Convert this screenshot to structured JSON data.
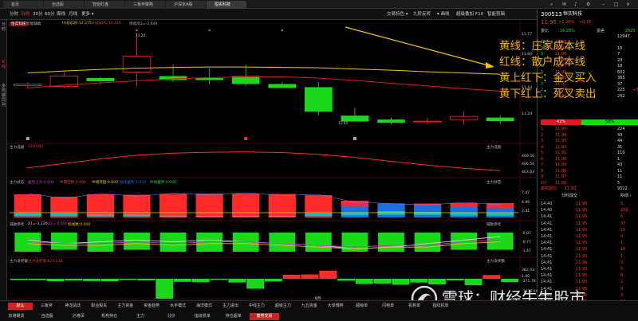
{
  "top_tabs": [
    "首页",
    "自选股",
    "智能盯盘",
    "三板斧策略",
    "沪深京A股",
    "恒实科技"
  ],
  "toolbar": {
    "left": [
      "分时",
      "日线",
      "30分",
      "60分",
      "周线",
      "月线",
      "更多 ▾"
    ],
    "right": [
      "交易特色 ▾",
      "九阶反转",
      "▾ 画线",
      "超级叠加",
      "F10",
      "智能剪辑"
    ],
    "right_icons": [
      "search-icon",
      "mail-icon",
      "notification-icon",
      "settings-icon",
      "minimize-icon",
      "maximize-icon",
      "close-icon"
    ]
  },
  "left_nav": [
    "分时",
    "K线",
    "多周期同列"
  ],
  "main_panel": {
    "name": "恒实科技",
    "tag": "智能辅助",
    "ma": [
      "HHJSJDB:12.275",
      "HHJSJDC:12.420",
      "感观高3=-2.649"
    ],
    "price_labels": [
      "11.77",
      "11.60",
      "11.44",
      "11.24"
    ],
    "high_label": "13.20",
    "low_label": "11.44"
  },
  "panel2": {
    "title": "主力选股",
    "value": "420.090",
    "right_title": "主力选股",
    "axis": [
      "409.50",
      "406.56",
      "403.63"
    ]
  },
  "panel3": {
    "title": "主力状态",
    "items": [
      "蓄势上升:0.000",
      "中期空换:0.900",
      "中线持盘:0.000",
      "短线蓄势:1.252",
      "中线蓄势:0.000"
    ],
    "right_title": "主力状态",
    "axis": [
      "7.47",
      "4.96",
      "2.41"
    ]
  },
  "panel4": {
    "title": "辅助参考",
    "items": [
      "X1=-1.120",
      "X2=-0.690",
      "标线数:0.000"
    ],
    "right_title": "辅助参考",
    "axis": [
      "-0.07",
      "-0.77",
      "-1.47"
    ]
  },
  "panel5": {
    "title": "主力净买额",
    "value": "主力净买额:823.238",
    "right_title": "主力净买额",
    "axis": [
      "382.03",
      "1.00",
      "-371.78",
      "-1476.66"
    ]
  },
  "x_axis_label": "8月",
  "quote": {
    "code": "300513",
    "name": "恒实科技",
    "price": "11.95",
    "change": "+1.36%",
    "change_amt": "+0.16",
    "wb_label": "委比",
    "wb_value": "-16.28%",
    "wc_label": "委差",
    "wc_value": "-2625",
    "volume": "12947",
    "ratio_sell": "42%",
    "ratio_buy": "58%",
    "sell_rows": [
      [
        "10",
        "11.98",
        ""
      ],
      [
        "9",
        "11.97",
        "16"
      ],
      [
        "8",
        "11.96",
        "7"
      ],
      [
        "7",
        "11.96",
        "23"
      ],
      [
        "6",
        "11.97",
        "18"
      ],
      [
        "5",
        "11.96",
        "602"
      ],
      [
        "4",
        "11.96",
        "365"
      ],
      [
        "3",
        "11.97",
        "37"
      ],
      [
        "2",
        "11.97",
        "225"
      ],
      [
        "1",
        "11.96",
        "242"
      ]
    ],
    "sell_changes": [
      "",
      "",
      "",
      "",
      "",
      "",
      "",
      "",
      "+3",
      ""
    ],
    "buy_rows": [
      [
        "1",
        "11.95",
        "224"
      ],
      [
        "2",
        "11.94",
        "43"
      ],
      [
        "3",
        "11.93",
        "44"
      ],
      [
        "4",
        "11.92",
        "31"
      ],
      [
        "5",
        "11.91",
        "110"
      ],
      [
        "6",
        "11.90",
        "1"
      ],
      [
        "7",
        "11.89",
        "43"
      ],
      [
        "8",
        "11.88",
        "11"
      ],
      [
        "9",
        "11.87",
        "11"
      ],
      [
        "10",
        "11.86",
        "5"
      ]
    ],
    "avg_label": "委买期均",
    "avg_value": "11.60",
    "avg_vol": "9322",
    "trade_header_left": "分时成交",
    "trade_header_right": "明细 ›",
    "trades": [
      [
        "14:40",
        "11.95",
        "5"
      ],
      [
        "14:40",
        "11.95",
        "208"
      ],
      [
        "14:41",
        "11.95",
        "6"
      ],
      [
        "14:41",
        "11.95",
        "37"
      ],
      [
        "14:41",
        "11.95",
        "10"
      ],
      [
        "14:41",
        "11.95",
        "4"
      ],
      [
        "14:41",
        "11.95",
        "1"
      ],
      [
        "14:41",
        "11.95",
        "16"
      ],
      [
        "14:41",
        "11.95",
        "1"
      ],
      [
        "14:41",
        "11.96",
        "3"
      ],
      [
        "14:41",
        "11.95",
        "5"
      ],
      [
        "14:41",
        "11.95",
        "8"
      ],
      [
        "14:41",
        "11.95",
        "2"
      ],
      [
        "14:41",
        "11.95",
        "9"
      ],
      [
        "14:41",
        "11.96",
        "3"
      ],
      [
        "14:41",
        "11.95",
        "10"
      ]
    ]
  },
  "annotation": [
    "黄线：庄家成本线",
    "红线：散户成本线",
    "黄上红下：金叉买入",
    "黄下红上：死叉卖出"
  ],
  "watermark": "雪球：财经牛牛股市",
  "bottom_tabs_row1": [
    "默认",
    "三板斧",
    "神龙战法",
    "职业股东",
    "主力资金",
    "资金趋势",
    "水手模式",
    "海洋模式",
    "主力进出",
    "中线主力",
    "超级主力",
    "九五资金",
    "大单博弈",
    "超级单",
    "闪电单",
    "机构单",
    "指纹机单"
  ],
  "bottom_tabs_row2": [
    "京港期货",
    "自选股",
    "沪港深",
    "机构持仓",
    "主力",
    "分价",
    "指纹机单",
    "持仓超单",
    "蓄势交易"
  ],
  "chart_data": {
    "type": "candlestick",
    "candles": [
      {
        "o": 11.86,
        "h": 11.95,
        "l": 11.8,
        "c": 11.9
      },
      {
        "o": 11.84,
        "h": 12.2,
        "l": 11.8,
        "c": 12.1
      },
      {
        "o": 12.05,
        "h": 12.08,
        "l": 11.9,
        "c": 11.97
      },
      {
        "o": 12.2,
        "h": 13.2,
        "l": 11.83,
        "c": 12.6
      },
      {
        "o": 12.1,
        "h": 12.4,
        "l": 11.95,
        "c": 12.0
      },
      {
        "o": 12.05,
        "h": 12.3,
        "l": 11.9,
        "c": 12.0
      },
      {
        "o": 12.1,
        "h": 12.4,
        "l": 11.85,
        "c": 11.9
      },
      {
        "o": 11.9,
        "h": 11.95,
        "l": 11.8,
        "c": 11.8
      },
      {
        "o": 11.82,
        "h": 11.95,
        "l": 11.1,
        "c": 11.2
      },
      {
        "o": 11.1,
        "h": 11.3,
        "l": 10.95,
        "c": 10.95
      },
      {
        "o": 11.0,
        "h": 11.05,
        "l": 10.88,
        "c": 10.92
      },
      {
        "o": 10.96,
        "h": 11.05,
        "l": 10.88,
        "c": 10.96
      },
      {
        "o": 11.0,
        "h": 11.2,
        "l": 10.86,
        "c": 11.08
      },
      {
        "o": 11.05,
        "h": 11.1,
        "l": 10.88,
        "c": 10.96
      }
    ],
    "yellow_line": [
      12.18,
      12.23,
      12.27,
      12.3,
      12.32,
      12.33,
      12.33,
      12.32,
      12.31,
      12.28,
      12.25,
      12.21,
      12.18,
      12.15
    ],
    "red_line": [
      11.8,
      11.87,
      11.93,
      11.98,
      12.03,
      12.06,
      12.08,
      12.08,
      12.05,
      11.99,
      11.92,
      11.85,
      11.78,
      11.72
    ],
    "panel2_line": [
      404.5,
      406.0,
      407.5,
      408.7,
      409.4,
      409.7,
      409.8,
      409.6,
      409.0,
      408.0,
      406.7,
      405.4,
      404.4,
      403.6
    ],
    "panel3_bars": [
      [
        0,
        5.8,
        1.0
      ],
      [
        0,
        5.2,
        1.0
      ],
      [
        0,
        5.8,
        0.8
      ],
      [
        0,
        5.7,
        0.8
      ],
      [
        0,
        5.9,
        0.5
      ],
      [
        0,
        6.0,
        0.4
      ],
      [
        0,
        6.0,
        0.4
      ],
      [
        0,
        5.9,
        0.4
      ],
      [
        0,
        5.6,
        1.0
      ],
      [
        1,
        4.2,
        1.3
      ],
      [
        1,
        3.3,
        1.6
      ],
      [
        1,
        3.5,
        1.4
      ],
      [
        1,
        3.6,
        1.2
      ],
      [
        1,
        3.6,
        1.1
      ]
    ],
    "panel4_bars": [
      1.0,
      0.9,
      1.0,
      0.9,
      1.0,
      1.0,
      1.0,
      1.0,
      1.0,
      1.0,
      1.0,
      1.0,
      0.9,
      0.9
    ],
    "panel4_x1": [
      0.3,
      0.1,
      0.2,
      0.3,
      0.2,
      0.3,
      0.2,
      0.1,
      0.0,
      -0.2,
      -0.1,
      0.1,
      0.3,
      0.5
    ],
    "panel4_x2": [
      0.2,
      0.1,
      0.1,
      0.2,
      0.1,
      0.2,
      0.2,
      0.1,
      0.0,
      -0.1,
      0.0,
      0.0,
      0.2,
      0.3
    ],
    "panel5_bars": [
      -35,
      -40,
      -110,
      -70,
      -100,
      -110,
      -25,
      -60,
      -1300,
      -150,
      -180,
      -20,
      -200,
      -620,
      -130,
      220,
      240,
      500,
      -80,
      -300,
      -280,
      -350,
      -200,
      -330,
      -60,
      -380,
      200,
      -170
    ]
  },
  "colors": {
    "up": "#ff2a2a",
    "down": "#1bd81b",
    "yellow": "#f2c40a",
    "red_line": "#d42020",
    "annotation": "#f5b400",
    "bg": "#000000"
  }
}
